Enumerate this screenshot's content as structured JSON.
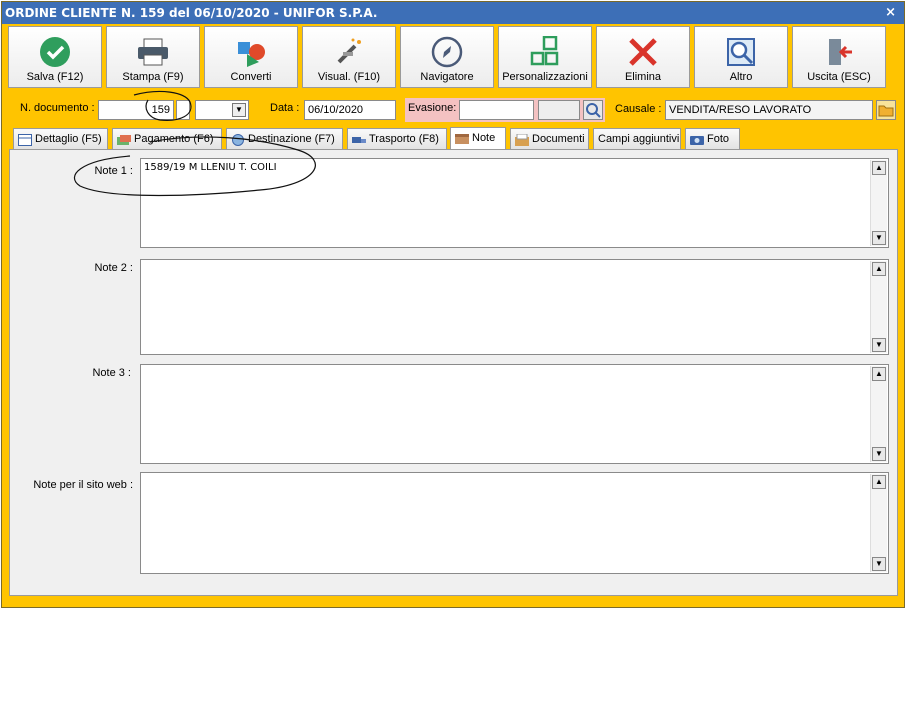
{
  "window": {
    "title": "ORDINE CLIENTE N. 159 del 06/10/2020 - UNIFOR S.P.A.",
    "close_glyph": "×"
  },
  "toolbar": [
    {
      "label": "Salva (F12)",
      "icon": "check-circle-icon"
    },
    {
      "label": "Stampa (F9)",
      "icon": "printer-icon"
    },
    {
      "label": "Converti",
      "icon": "convert-icon"
    },
    {
      "label": "Visual. (F10)",
      "icon": "magic-wand-icon"
    },
    {
      "label": "Navigatore",
      "icon": "compass-icon"
    },
    {
      "label": "Personalizzazioni",
      "icon": "grid-icon"
    },
    {
      "label": "Elimina",
      "icon": "delete-x-icon"
    },
    {
      "label": "Altro",
      "icon": "search-doc-icon"
    },
    {
      "label": "Uscita (ESC)",
      "icon": "exit-door-icon"
    }
  ],
  "header": {
    "doc_label": "N. documento :",
    "doc_number": "159",
    "data_label": "Data :",
    "data_value": "06/10/2020",
    "evasione_label": "Evasione:",
    "evasione_value": "",
    "causale_label": "Causale :",
    "causale_value": "VENDITA/RESO LAVORATO"
  },
  "tabs": [
    {
      "label": "Dettaglio (F5)"
    },
    {
      "label": "Pagamento (F6)"
    },
    {
      "label": "Destinazione (F7)"
    },
    {
      "label": "Trasporto (F8)"
    },
    {
      "label": "Note"
    },
    {
      "label": "Documenti"
    },
    {
      "label": "Campi aggiuntivi"
    },
    {
      "label": "Foto"
    }
  ],
  "notes": [
    {
      "label": "Note 1 :",
      "value": "1589/19 M  LLENIU  T.  COILI"
    },
    {
      "label": "Note 2 :",
      "value": ""
    },
    {
      "label": "Note 3 :",
      "value": ""
    },
    {
      "label": "Note per il sito web :",
      "value": ""
    }
  ],
  "colors": {
    "window_bg": "#ffc400",
    "titlebar": "#3d6fb7",
    "evasione_bg": "#f4c2c2"
  }
}
